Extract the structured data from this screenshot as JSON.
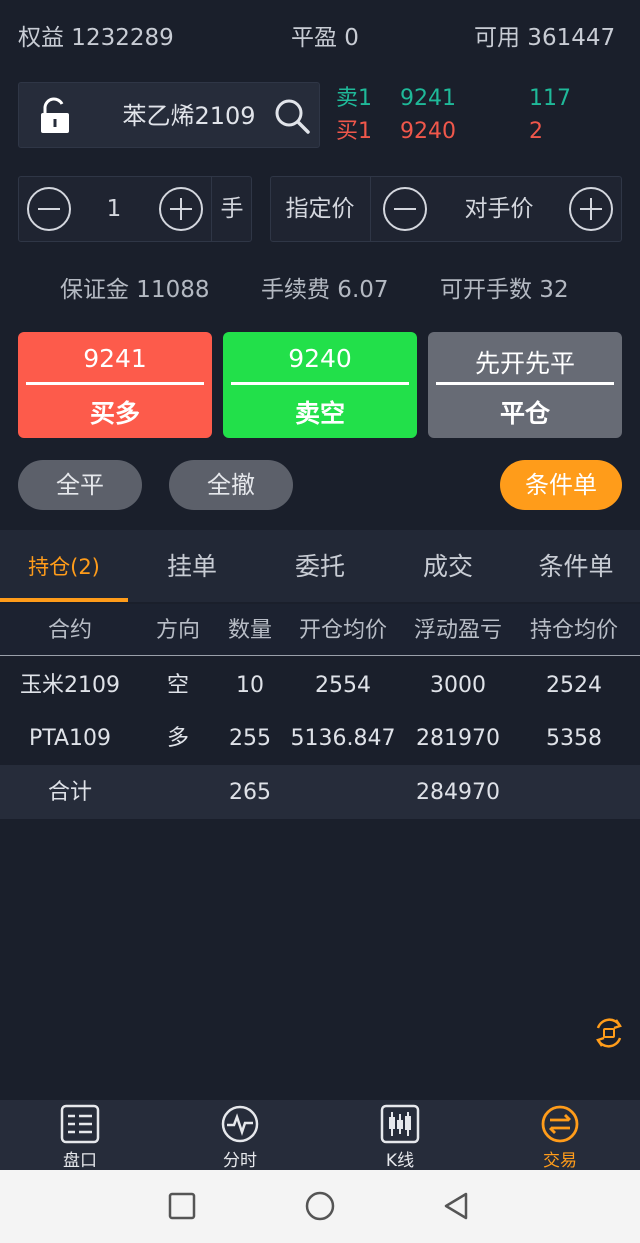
{
  "account": {
    "equity": "权益 1232289",
    "flat_profit": "平盈 0",
    "available": "可用 361447"
  },
  "contract": {
    "name": "苯乙烯2109",
    "icons": {
      "lock": "lock-open-icon",
      "search": "search-icon"
    }
  },
  "quotes": {
    "ask": {
      "label": "卖1",
      "price": "9241",
      "volume": "117"
    },
    "bid": {
      "label": "买1",
      "price": "9240",
      "volume": "2"
    }
  },
  "order": {
    "quantity": "1",
    "unit": "手",
    "price_type": "指定价",
    "price_mode": "对手价"
  },
  "info": {
    "margin": "保证金 11088",
    "fee": "手续费 6.07",
    "openable": "可开手数 32"
  },
  "actions": {
    "buy": {
      "price": "9241",
      "label": "买多"
    },
    "sell": {
      "price": "9240",
      "label": "卖空"
    },
    "close": {
      "price": "先开先平",
      "label": "平仓"
    }
  },
  "pills": {
    "close_all": "全平",
    "cancel_all": "全撤",
    "conditional": "条件单"
  },
  "tabs": [
    "持仓(2)",
    "挂单",
    "委托",
    "成交",
    "条件单"
  ],
  "table": {
    "headers": [
      "合约",
      "方向",
      "数量",
      "开仓均价",
      "浮动盈亏",
      "持仓均价"
    ],
    "rows": [
      [
        "玉米2109",
        "空",
        "10",
        "2554",
        "3000",
        "2524"
      ],
      [
        "PTA109",
        "多",
        "255",
        "5136.847",
        "281970",
        "5358"
      ]
    ],
    "total": [
      "合计",
      "",
      "265",
      "",
      "284970",
      ""
    ]
  },
  "bottom_nav": [
    {
      "label": "盘口",
      "icon": "orderbook-icon"
    },
    {
      "label": "分时",
      "icon": "timeshare-icon"
    },
    {
      "label": "K线",
      "icon": "candlestick-icon"
    },
    {
      "label": "交易",
      "icon": "trade-icon"
    }
  ],
  "colors": {
    "background": "#1a1f2b",
    "accent": "#ff9c1a",
    "up": "#f0574b",
    "down": "#1fb999",
    "buy_button": "#fd5b4b",
    "sell_button": "#22e04a"
  }
}
